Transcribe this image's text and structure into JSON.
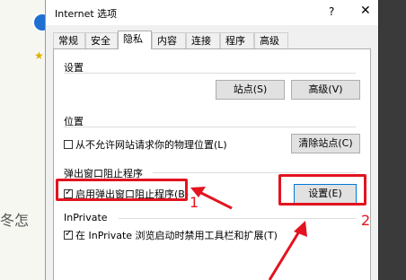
{
  "window": {
    "title": "Internet 选项",
    "help": "?",
    "close": "✕"
  },
  "tabs": [
    "常规",
    "安全",
    "隐私",
    "内容",
    "连接",
    "程序",
    "高级"
  ],
  "active_tab": "隐私",
  "settings": {
    "label": "设置",
    "sites_button": "站点(S)",
    "advanced_button": "高级(V)"
  },
  "location": {
    "label": "位置",
    "checkbox_label": "从不允许网站请求你的物理位置(L)",
    "checkbox_checked": false,
    "clear_sites_button": "清除站点(C)"
  },
  "popup": {
    "label": "弹出窗口阻止程序",
    "checkbox_label": "启用弹出窗口阻止程序(B)",
    "checkbox_checked": true,
    "settings_button": "设置(E)"
  },
  "inprivate": {
    "label": "InPrivate",
    "checkbox_label": "在 InPrivate 浏览启动时禁用工具栏和扩展(T)",
    "checkbox_checked": true
  },
  "annotations": {
    "step1": "1",
    "step2": "2",
    "color": "#e3131f"
  }
}
